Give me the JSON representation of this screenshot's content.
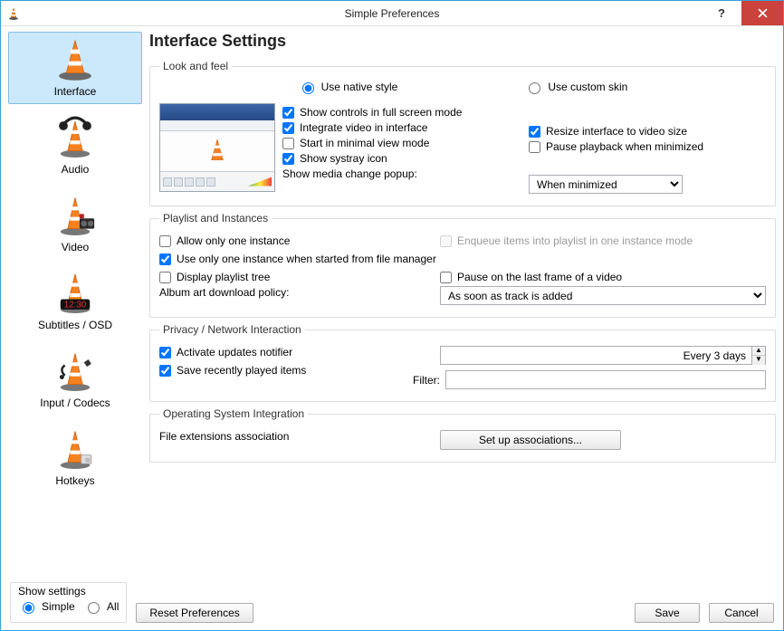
{
  "window": {
    "title": "Simple Preferences"
  },
  "sidebar": {
    "items": [
      {
        "label": "Interface"
      },
      {
        "label": "Audio"
      },
      {
        "label": "Video"
      },
      {
        "label": "Subtitles / OSD"
      },
      {
        "label": "Input / Codecs"
      },
      {
        "label": "Hotkeys"
      }
    ]
  },
  "page": {
    "title": "Interface Settings"
  },
  "look": {
    "legend": "Look and feel",
    "native": "Use native style",
    "custom": "Use custom skin",
    "show_controls_fs": "Show controls in full screen mode",
    "integrate_video": "Integrate video in interface",
    "resize_to_video": "Resize interface to video size",
    "start_minimal": "Start in minimal view mode",
    "pause_minimized": "Pause playback when minimized",
    "show_systray": "Show systray icon",
    "media_popup_label": "Show media change popup:",
    "media_popup_value": "When minimized"
  },
  "playlist": {
    "legend": "Playlist and Instances",
    "one_instance": "Allow only one instance",
    "enqueue": "Enqueue items into playlist in one instance mode",
    "one_instance_fm": "Use only one instance when started from file manager",
    "display_tree": "Display playlist tree",
    "pause_last_frame": "Pause on the last frame of a video",
    "album_art_label": "Album art download policy:",
    "album_art_value": "As soon as track is added"
  },
  "privacy": {
    "legend": "Privacy / Network Interaction",
    "updates": "Activate updates notifier",
    "updates_interval": "Every 3 days",
    "save_recent": "Save recently played items",
    "filter_label": "Filter:",
    "filter_value": ""
  },
  "os": {
    "legend": "Operating System Integration",
    "assoc_label": "File extensions association",
    "assoc_button": "Set up associations..."
  },
  "footer": {
    "show_settings": "Show settings",
    "simple": "Simple",
    "all": "All",
    "reset": "Reset Preferences",
    "save": "Save",
    "cancel": "Cancel"
  }
}
